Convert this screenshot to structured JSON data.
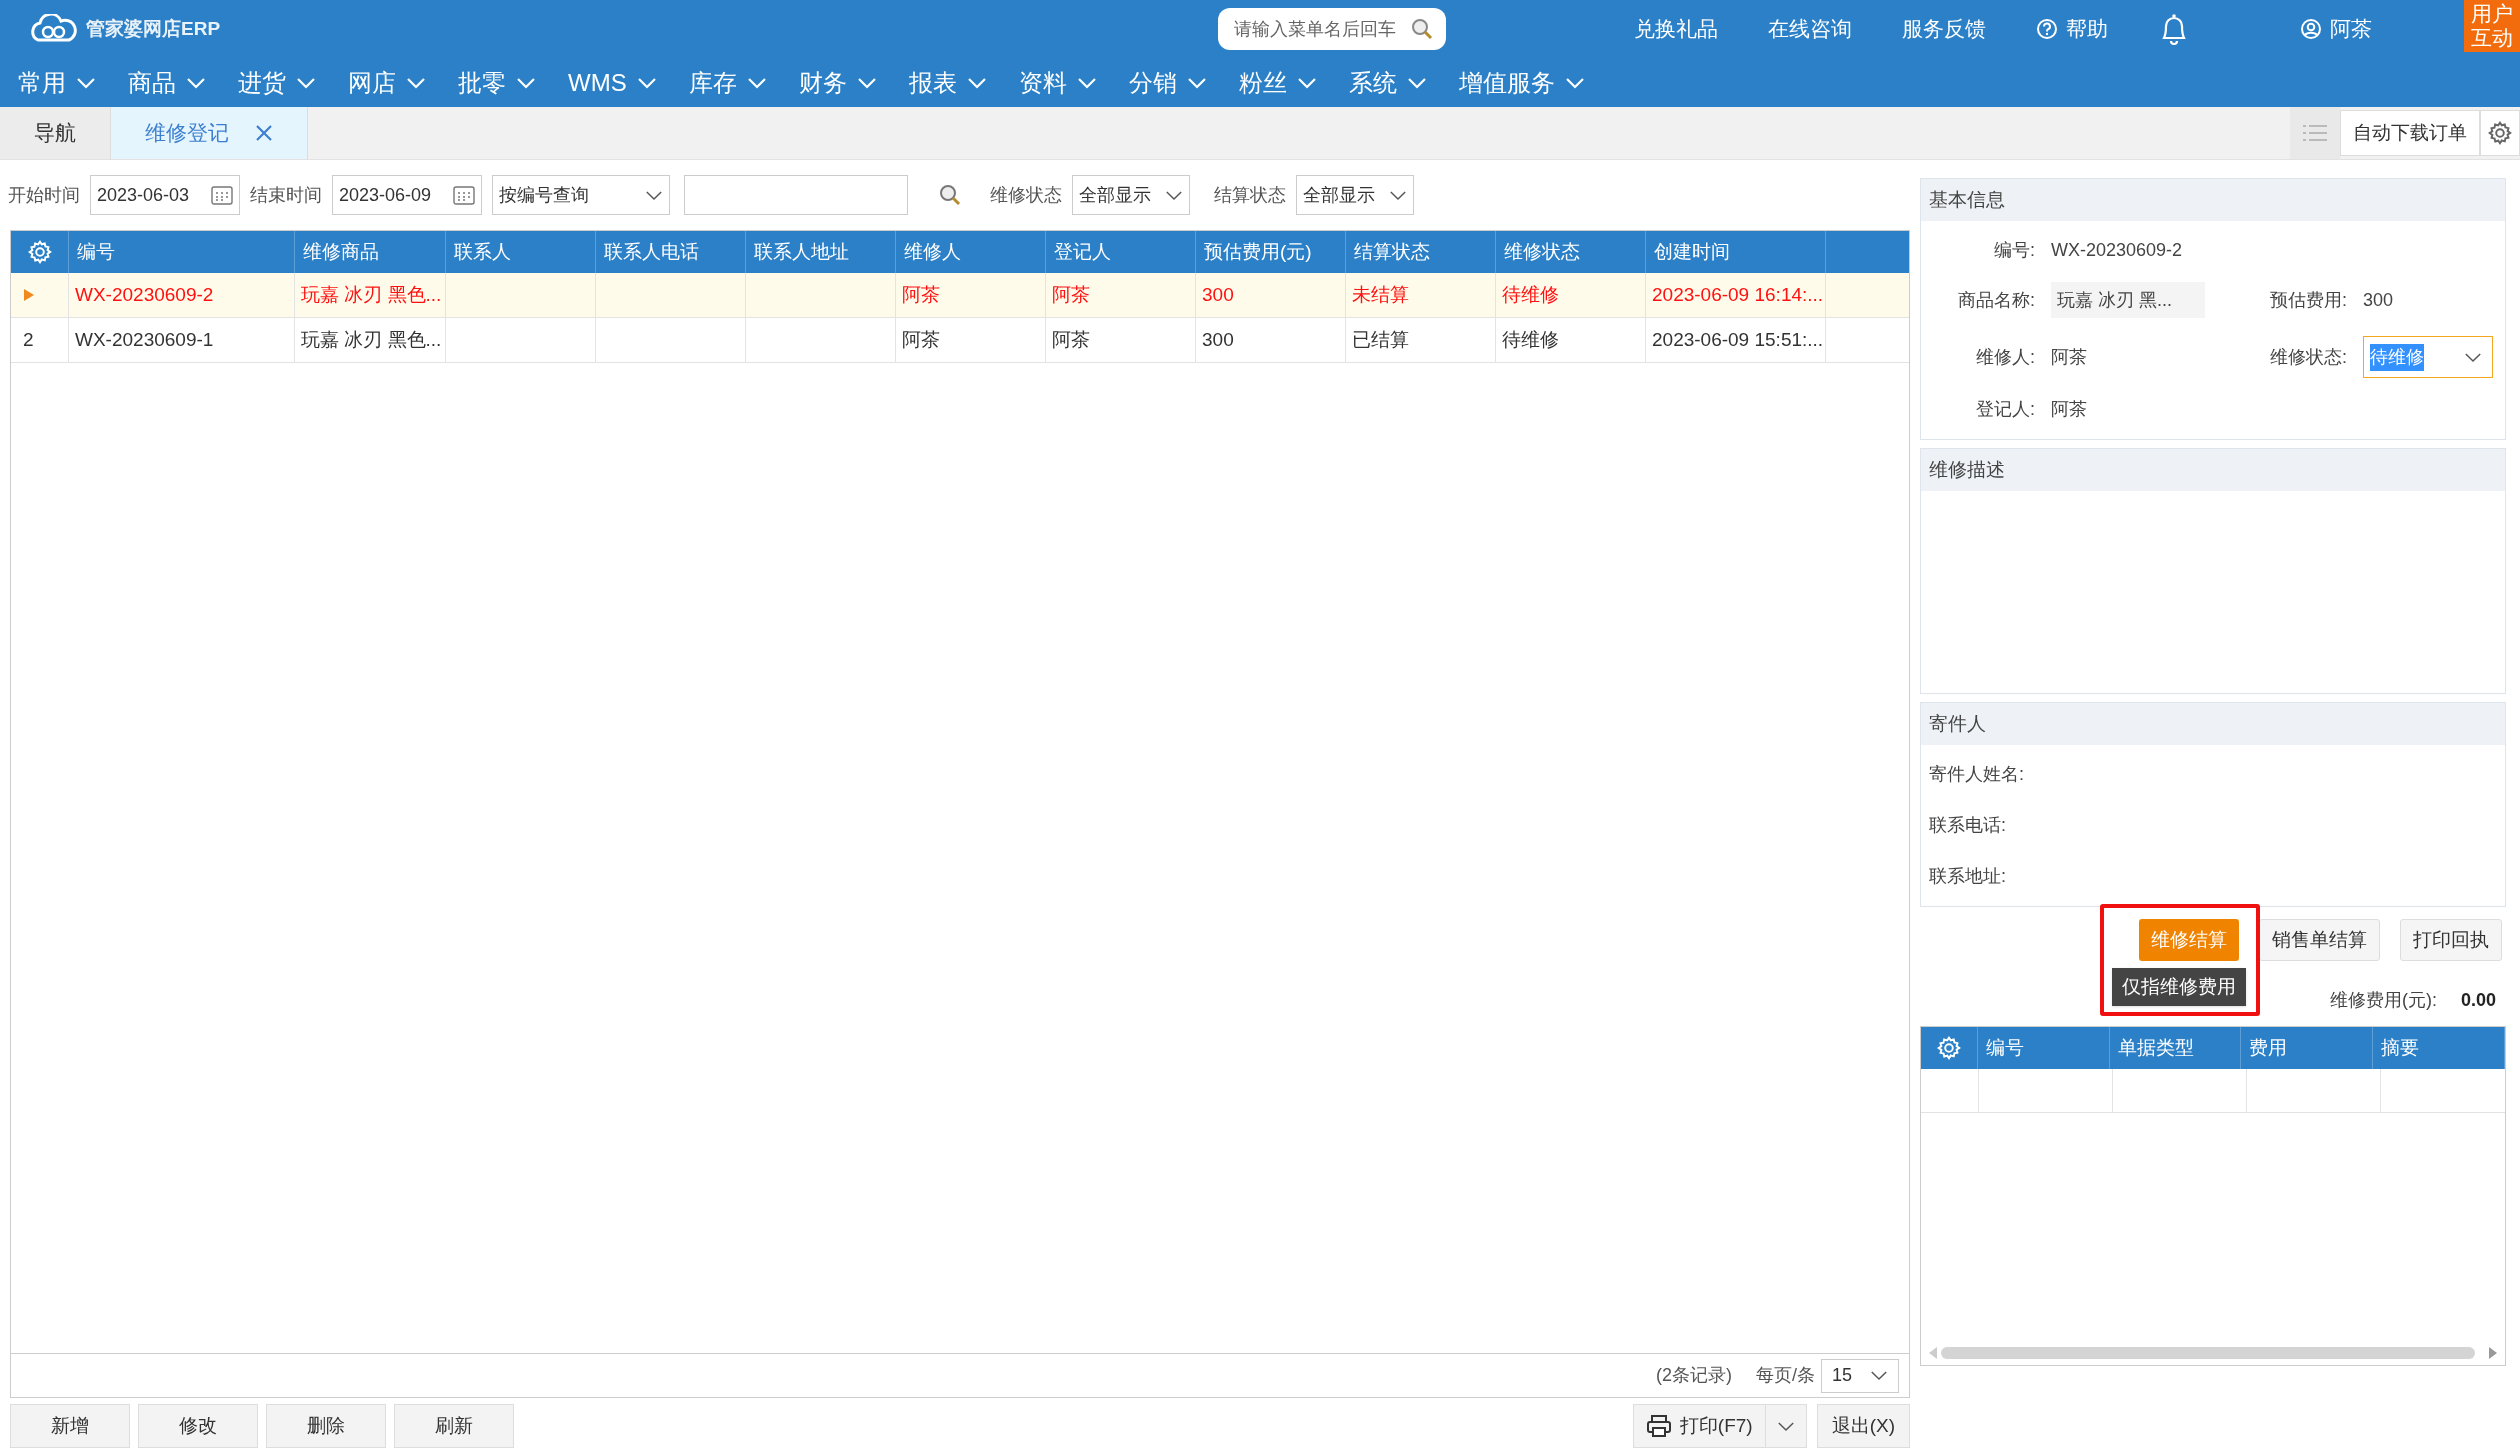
{
  "header": {
    "logo_text": "管家婆网店ERP",
    "search_placeholder": "请输入菜单名后回车",
    "links": [
      "兑换礼品",
      "在线咨询",
      "服务反馈"
    ],
    "help": "帮助",
    "user": "阿茶",
    "corner_badge": [
      "用户",
      "互动"
    ]
  },
  "menu": [
    "常用",
    "商品",
    "进货",
    "网店",
    "批零",
    "WMS",
    "库存",
    "财务",
    "报表",
    "资料",
    "分销",
    "粉丝",
    "系统",
    "增值服务"
  ],
  "tabs": [
    {
      "label": "导航",
      "selected": false,
      "closable": false
    },
    {
      "label": "维修登记",
      "selected": true,
      "closable": true
    }
  ],
  "tab_tools": {
    "button": "自动下载订单"
  },
  "filters": {
    "start_label": "开始时间",
    "start_date": "2023-06-03",
    "end_label": "结束时间",
    "end_date": "2023-06-09",
    "query_mode": "按编号查询",
    "repair_status_label": "维修状态",
    "repair_status": "全部显示",
    "settle_label": "结算状态",
    "settle_status": "全部显示"
  },
  "table": {
    "columns": [
      "编号",
      "维修商品",
      "联系人",
      "联系人电话",
      "联系人地址",
      "维修人",
      "登记人",
      "预估费用(元)",
      "结算状态",
      "维修状态",
      "创建时间"
    ],
    "rows": [
      {
        "selected": true,
        "cells": [
          "WX-20230609-2",
          "玩嘉 冰刃 黑色...",
          "",
          "",
          "",
          "阿茶",
          "阿茶",
          "300",
          "未结算",
          "待维修",
          "2023-06-09 16:14:..."
        ]
      },
      {
        "selected": false,
        "row_number": "2",
        "cells": [
          "WX-20230609-1",
          "玩嘉 冰刃 黑色...",
          "",
          "",
          "",
          "阿茶",
          "阿茶",
          "300",
          "已结算",
          "待维修",
          "2023-06-09 15:51:..."
        ]
      }
    ]
  },
  "pager": {
    "record_count": "(2条记录)",
    "per_page_label": "每页/条",
    "per_page": "15"
  },
  "actions": [
    "新增",
    "修改",
    "删除",
    "刷新"
  ],
  "print_button": "打印(F7)",
  "exit_button": "退出(X)",
  "detail": {
    "basic": {
      "title": "基本信息",
      "fields": [
        {
          "label": "编号:",
          "value": "WX-20230609-2",
          "kind": "text"
        },
        {
          "label": "商品名称:",
          "value": "玩嘉 冰刃 黑...",
          "kind": "readonly"
        },
        {
          "label": "预估费用:",
          "value": "300",
          "kind": "text"
        },
        {
          "label": "维修人:",
          "value": "阿茶",
          "kind": "text"
        },
        {
          "label": "维修状态:",
          "value": "待维修",
          "kind": "select"
        },
        {
          "label": "登记人:",
          "value": "阿茶",
          "kind": "text"
        }
      ]
    },
    "description": {
      "title": "维修描述"
    },
    "sender": {
      "title": "寄件人",
      "fields": [
        "寄件人姓名:",
        "联系电话:",
        "联系地址:"
      ]
    },
    "buttons": [
      {
        "label": "维修结算",
        "primary": true
      },
      {
        "label": "销售单结算",
        "primary": false
      },
      {
        "label": "打印回执",
        "primary": false
      }
    ],
    "tooltip": "仅指维修费用",
    "fee": {
      "label": "维修费用(元):",
      "value": "0.00"
    },
    "sub_table": {
      "columns": [
        "编号",
        "单据类型",
        "费用",
        "摘要"
      ]
    }
  }
}
